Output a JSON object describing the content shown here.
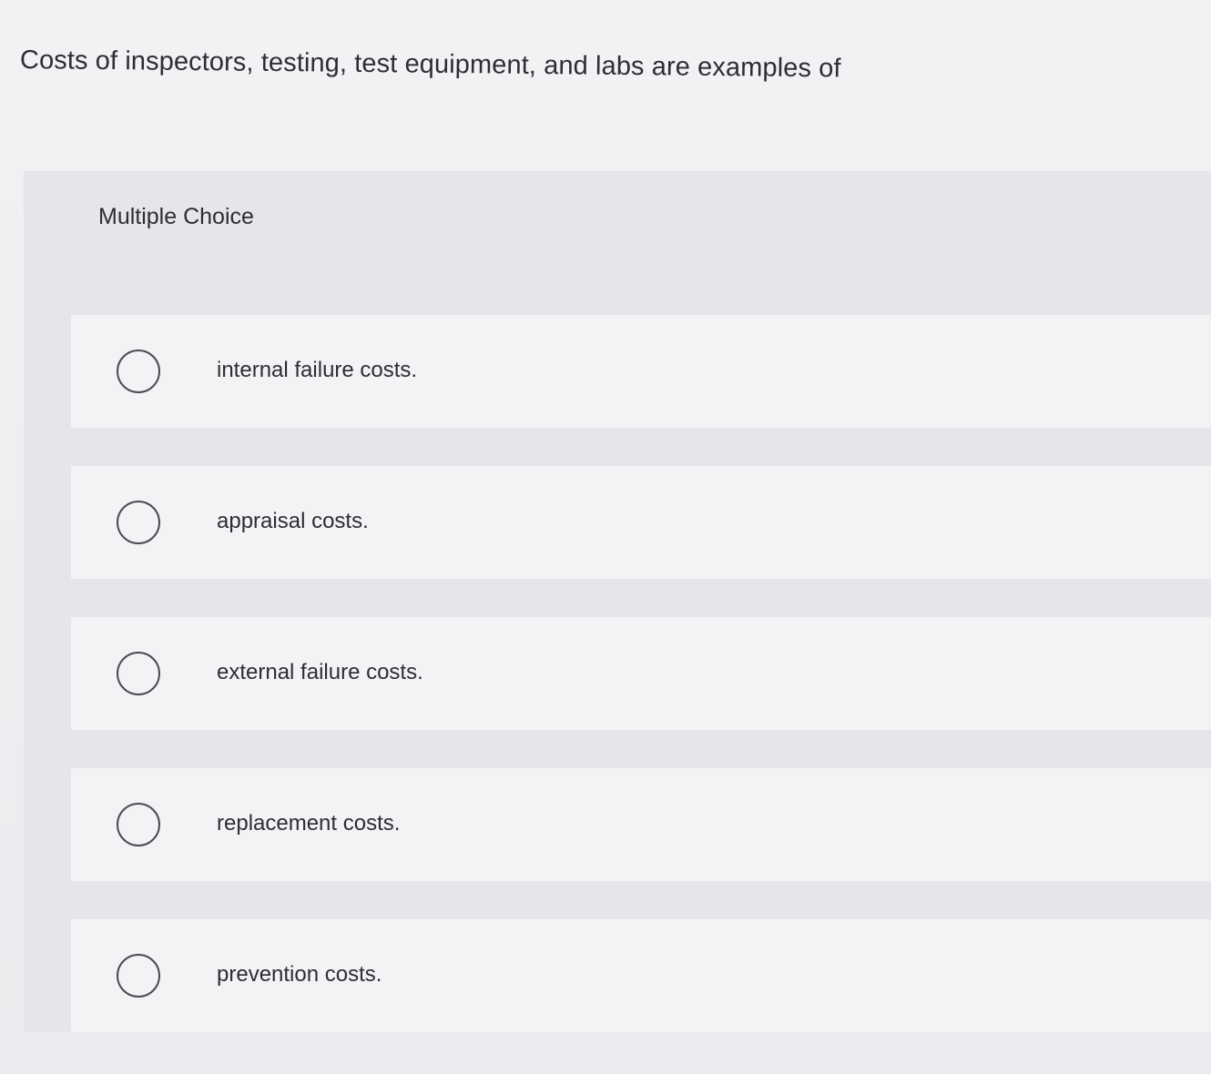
{
  "question": {
    "text": "Costs of inspectors, testing, test equipment, and labs are examples of"
  },
  "panel": {
    "label": "Multiple Choice"
  },
  "options": [
    {
      "label": "internal failure costs."
    },
    {
      "label": "appraisal costs."
    },
    {
      "label": "external failure costs."
    },
    {
      "label": "replacement costs."
    },
    {
      "label": "prevention costs."
    }
  ],
  "colors": {
    "page_background": "#eef0f2",
    "panel_background": "#e4e6e9",
    "option_background": "#f2f3f5",
    "text": "#2c2e31",
    "radio_border": "#4a4c50"
  }
}
